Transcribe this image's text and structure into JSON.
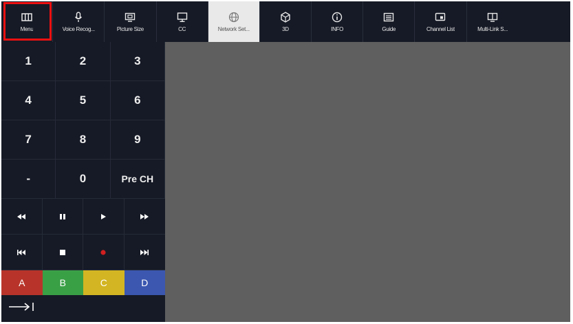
{
  "toolbar": {
    "items": [
      {
        "label": "Menu",
        "icon": "menu-icon"
      },
      {
        "label": "Voice Recog...",
        "icon": "microphone-icon"
      },
      {
        "label": "Picture Size",
        "icon": "picture-size-icon"
      },
      {
        "label": "CC",
        "icon": "closed-caption-icon"
      },
      {
        "label": "Network Set...",
        "icon": "globe-icon"
      },
      {
        "label": "3D",
        "icon": "3d-cube-icon"
      },
      {
        "label": "INFO",
        "icon": "info-icon"
      },
      {
        "label": "Guide",
        "icon": "guide-icon"
      },
      {
        "label": "Channel List",
        "icon": "channel-list-icon"
      },
      {
        "label": "Multi-Link S...",
        "icon": "multi-link-icon"
      }
    ],
    "active_item": "Network Set...",
    "highlighted_item": "Menu"
  },
  "keypad": {
    "keys": [
      "1",
      "2",
      "3",
      "4",
      "5",
      "6",
      "7",
      "8",
      "9",
      "-",
      "0",
      "Pre CH"
    ],
    "media_row_1": [
      "rewind",
      "pause",
      "play",
      "fast-forward"
    ],
    "media_row_2": [
      "previous",
      "stop",
      "record",
      "next"
    ],
    "color_keys": [
      {
        "label": "A",
        "color": "#b8342a"
      },
      {
        "label": "B",
        "color": "#3aa046"
      },
      {
        "label": "C",
        "color": "#d3b523"
      },
      {
        "label": "D",
        "color": "#3b57b0"
      }
    ],
    "exit_icon": "arrow-to-bar-icon"
  },
  "colors": {
    "toolbar_bg": "#161a26",
    "content_bg": "#5f5f5f",
    "highlight_border": "#ee1111",
    "active_bg": "#e9e9ea",
    "record": "#d02020"
  }
}
